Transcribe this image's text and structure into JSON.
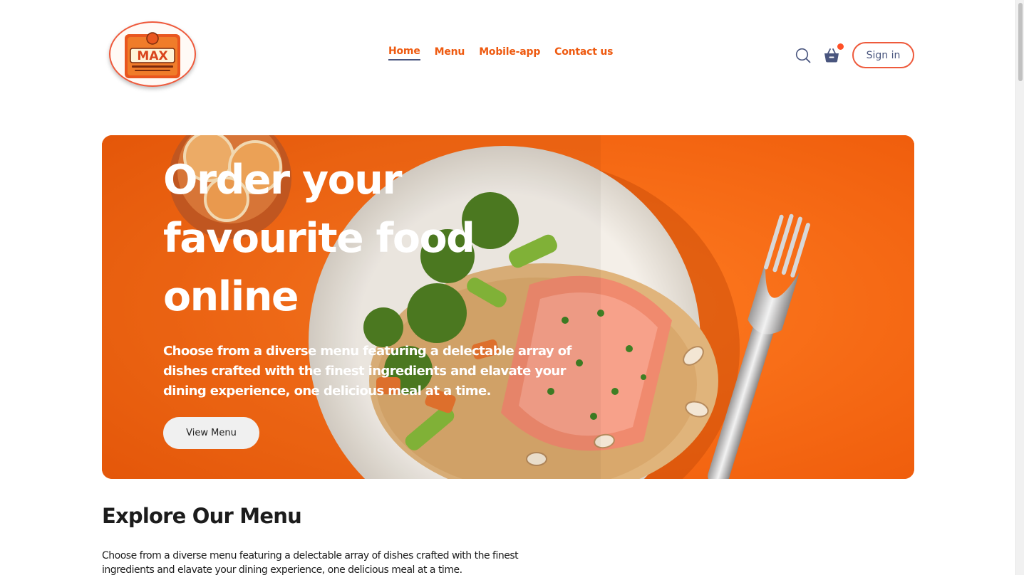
{
  "brand": {
    "logo_text": "MAX",
    "logo_alt": "Max restaurant logo"
  },
  "nav": {
    "links": [
      {
        "label": "Home",
        "active": true
      },
      {
        "label": "Menu",
        "active": false
      },
      {
        "label": "Mobile-app",
        "active": false
      },
      {
        "label": "Contact us",
        "active": false
      }
    ],
    "icons": [
      "search-icon",
      "basket-icon"
    ],
    "cart_has_items": true,
    "signin_label": "Sign in"
  },
  "hero": {
    "title": "Order your favourite food online",
    "description": "Choose from a diverse menu featuring a delectable array of dishes crafted with the finest ingredients and elavate your dining experience, one delicious meal at a time.",
    "button_label": "View Menu"
  },
  "explore": {
    "title": "Explore Our Menu",
    "description": "Choose from a diverse menu featuring a delectable array of dishes crafted with the finest ingredients and elavate your dining experience, one delicious meal at a time."
  },
  "colors": {
    "accent": "#ee5a10",
    "hero_bg": "#f2620f",
    "nav_text": "#49557e",
    "cart_dot": "#ff5027"
  }
}
